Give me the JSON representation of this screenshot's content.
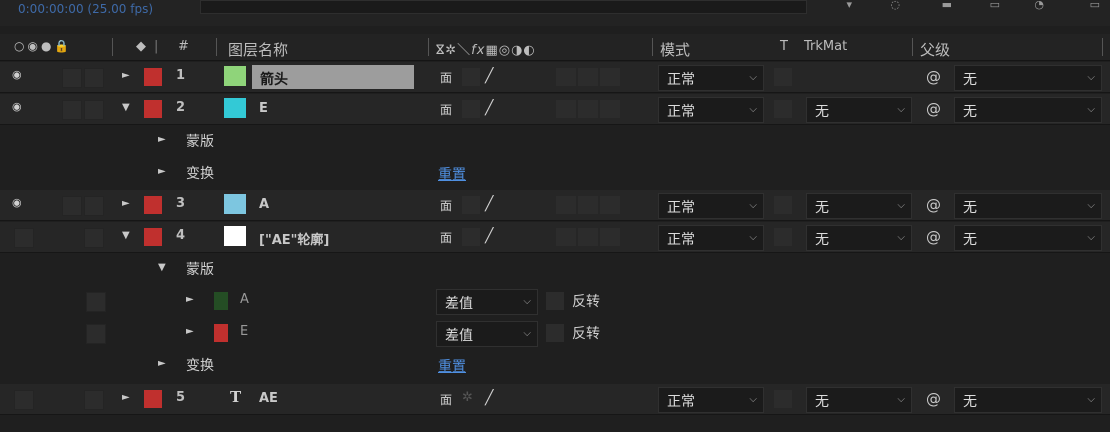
{
  "topbar": {
    "timecode": "0:00:00:00 (25.00 fps)"
  },
  "header": {
    "icons_left": "o◉●🔒",
    "label_col": "◆",
    "num_col": "#",
    "layer_name": "图层名称",
    "switches": "ⴵ✲\\fx▦◎◑◐",
    "mode": "模式",
    "t": "T",
    "trkmat": "TrkMat",
    "parent": "父级"
  },
  "layers": [
    {
      "num": "1",
      "name": "箭头",
      "swatch": "#8fd47a",
      "label": "#c0302e",
      "eye": true,
      "expanded": false,
      "mode": "正常",
      "trkmat": "",
      "parent": "无"
    },
    {
      "num": "2",
      "name": "E",
      "swatch": "#33c9d6",
      "label": "#c0302e",
      "eye": true,
      "expanded": true,
      "mode": "正常",
      "trkmat": "无",
      "parent": "无"
    },
    {
      "num": "3",
      "name": "A",
      "swatch": "#7dc6e0",
      "label": "#c0302e",
      "eye": true,
      "expanded": false,
      "mode": "正常",
      "trkmat": "无",
      "parent": "无"
    },
    {
      "num": "4",
      "name": "[\"AE\"轮廓]",
      "swatch": "#ffffff",
      "label": "#c0302e",
      "eye": false,
      "expanded": true,
      "mode": "正常",
      "trkmat": "无",
      "parent": "无"
    },
    {
      "num": "5",
      "name": "AE",
      "label": "#c0302e",
      "eye": false,
      "expanded": false,
      "mode": "正常",
      "trkmat": "无",
      "parent": "无"
    }
  ],
  "groups": {
    "masks": "蒙版",
    "transform": "变换",
    "reset": "重置"
  },
  "masks": [
    {
      "name": "A",
      "color": "#244d24",
      "mode": "差值",
      "invert": "反转"
    },
    {
      "name": "E",
      "color": "#c0302e",
      "mode": "差值",
      "invert": "反转"
    }
  ],
  "glyphs": {
    "collapsed": "►",
    "expanded": "▼",
    "chevron": "⌵",
    "parent_icon": "@",
    "quality_q": "⾯",
    "quality_slash": "╱",
    "eye": "◉",
    "text_layer": "T"
  }
}
